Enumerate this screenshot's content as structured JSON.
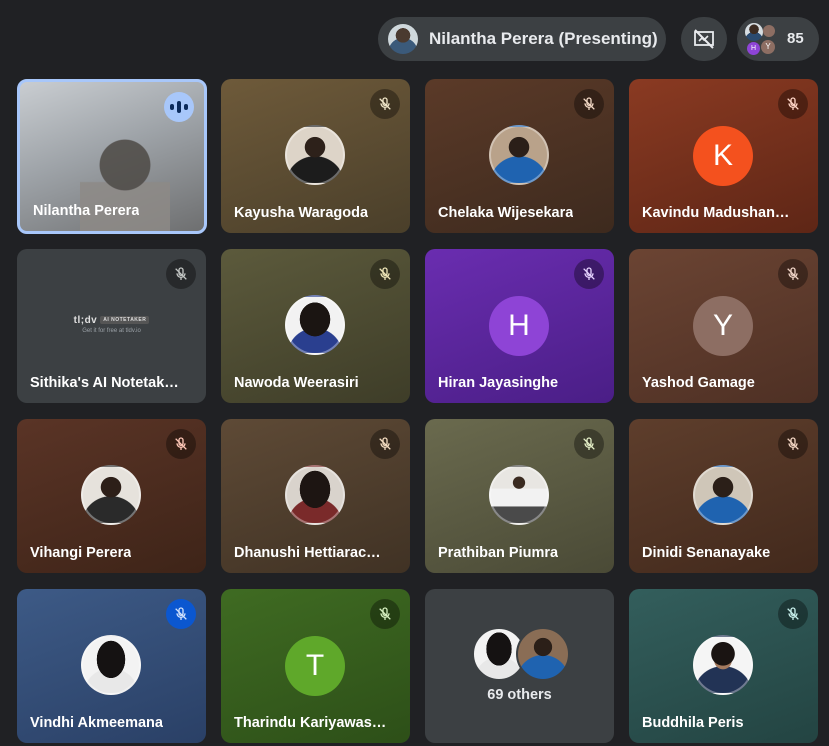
{
  "topbar": {
    "presenter_label": "Nilantha Perera (Presenting)",
    "participant_count": "85",
    "pill_mini_avatars": [
      "H",
      "Y"
    ]
  },
  "tiles": [
    {
      "name": "Nilantha Perera",
      "kind": "video",
      "speaking": true
    },
    {
      "name": "Kayusha Waragoda",
      "kind": "photo",
      "muted": true
    },
    {
      "name": "Chelaka Wijesekara",
      "kind": "photo",
      "muted": true
    },
    {
      "name": "Kavindu Madushan…",
      "kind": "letter",
      "letter": "K",
      "muted": true
    },
    {
      "name": "Sithika's AI Notetak…",
      "kind": "notetaker",
      "muted": true
    },
    {
      "name": "Nawoda Weerasiri",
      "kind": "photo",
      "muted": true
    },
    {
      "name": "Hiran Jayasinghe",
      "kind": "letter",
      "letter": "H",
      "muted": true
    },
    {
      "name": "Yashod Gamage",
      "kind": "letter",
      "letter": "Y",
      "muted": true
    },
    {
      "name": "Vihangi Perera",
      "kind": "photo",
      "muted": true
    },
    {
      "name": "Dhanushi Hettiarac…",
      "kind": "photo",
      "muted": true
    },
    {
      "name": "Prathiban Piumra",
      "kind": "photo",
      "muted": true
    },
    {
      "name": "Dinidi Senanayake",
      "kind": "photo",
      "muted": true
    },
    {
      "name": "Vindhi Akmeemana",
      "kind": "photo",
      "muted": true
    },
    {
      "name": "Tharindu Kariyawas…",
      "kind": "letter",
      "letter": "T",
      "muted": true
    },
    {
      "name": "",
      "kind": "others",
      "others_label": "69 others"
    },
    {
      "name": "Buddhila Peris",
      "kind": "photo",
      "muted": true
    }
  ],
  "notetaker": {
    "brand": "tl;dv",
    "badge": "AI NOTETAKER",
    "sub": "Get it for free at tldv.io"
  },
  "colors": {
    "background": "#202124",
    "speaking_ring": "#a8c7fa",
    "letter_K": "#f4511e",
    "letter_H": "#8e44d6",
    "letter_Y": "#8d6e63",
    "letter_T": "#5fa82a"
  },
  "icons": [
    "mic-off-icon",
    "speaking-indicator-icon",
    "presentation-off-icon",
    "people-icon"
  ]
}
